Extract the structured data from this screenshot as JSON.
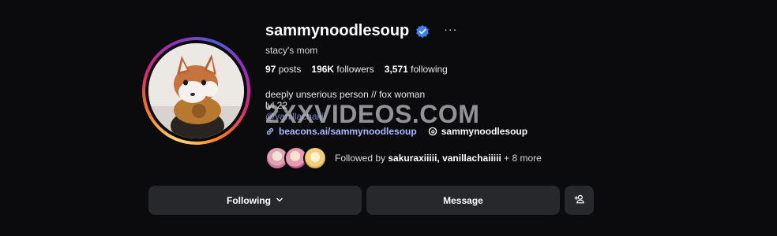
{
  "profile": {
    "username": "sammynoodlesoup",
    "display_name": "stacy's mom",
    "verified": true
  },
  "stats": {
    "posts_count": "97",
    "posts_label": "posts",
    "followers_count": "196K",
    "followers_label": "followers",
    "following_count": "3,571",
    "following_label": "following"
  },
  "bio": {
    "line1": "deeply unserious person // fox woman",
    "line2": "lvl 22",
    "handle": "@vanillachaiiii"
  },
  "links": {
    "external": "beacons.ai/sammynoodlesoup",
    "threads": "sammynoodlesoup"
  },
  "followed_by": {
    "prefix": "Followed by ",
    "names": "sakuraxiiiii, vanillachaiiiii",
    "suffix": " + 8 more"
  },
  "buttons": {
    "following": "Following",
    "message": "Message"
  },
  "watermark": "2XXVIDEOS.COM",
  "colors": {
    "background": "#0b0b0d",
    "button": "#26282c",
    "link": "#a8b9ff",
    "verified": "#3b82f6"
  },
  "icons": [
    "verified-badge-icon",
    "more-icon",
    "link-icon",
    "threads-icon",
    "chevron-down-icon",
    "add-person-icon"
  ]
}
